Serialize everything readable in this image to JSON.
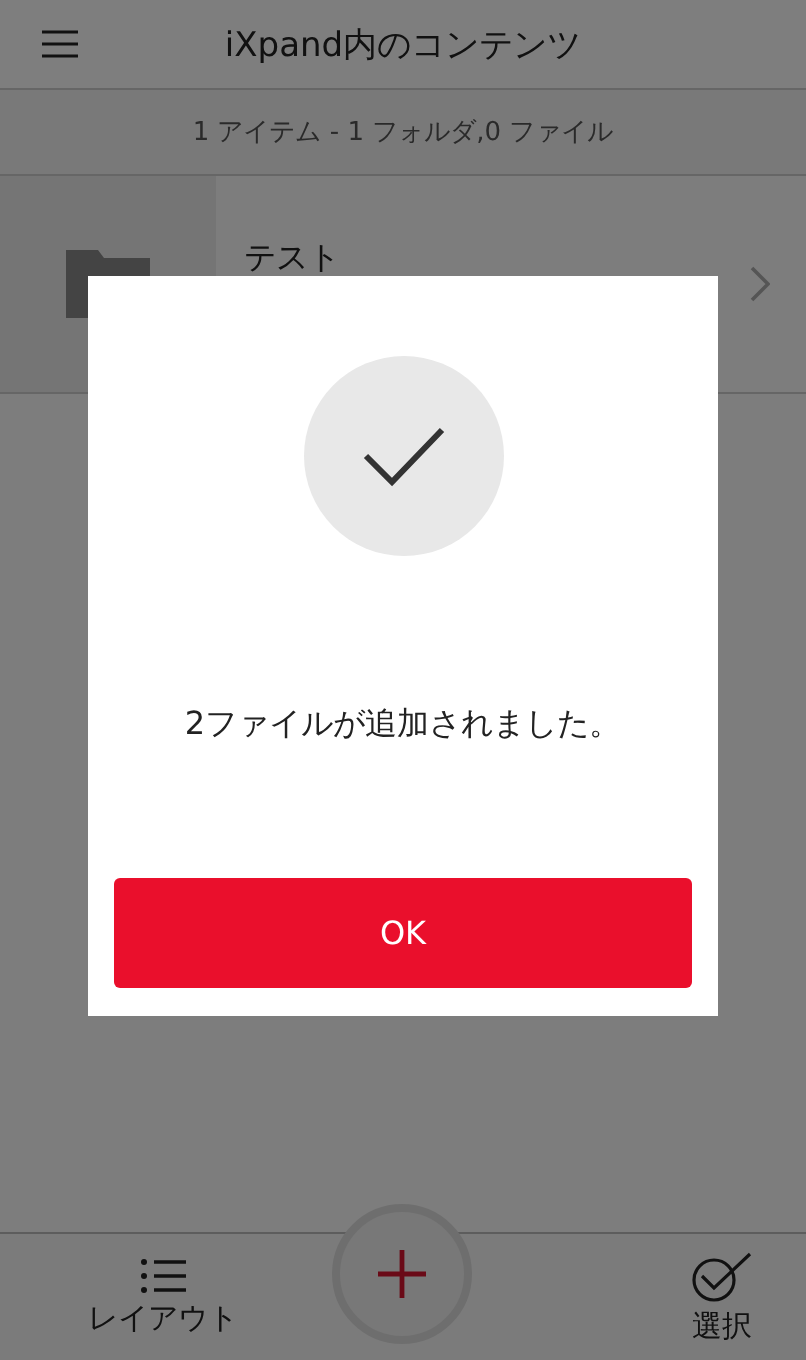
{
  "header": {
    "title": "iXpand内のコンテンツ"
  },
  "summary": "1 アイテム - 1 フォルダ,0 ファイル",
  "items": [
    {
      "name": "テスト"
    }
  ],
  "toolbar": {
    "buttons": [
      {
        "kind": "layout",
        "label": "レイアウト"
      },
      {
        "kind": "select",
        "label": "選択"
      }
    ]
  },
  "dialog": {
    "message": "2ファイルが追加されました。",
    "button": "OK"
  }
}
